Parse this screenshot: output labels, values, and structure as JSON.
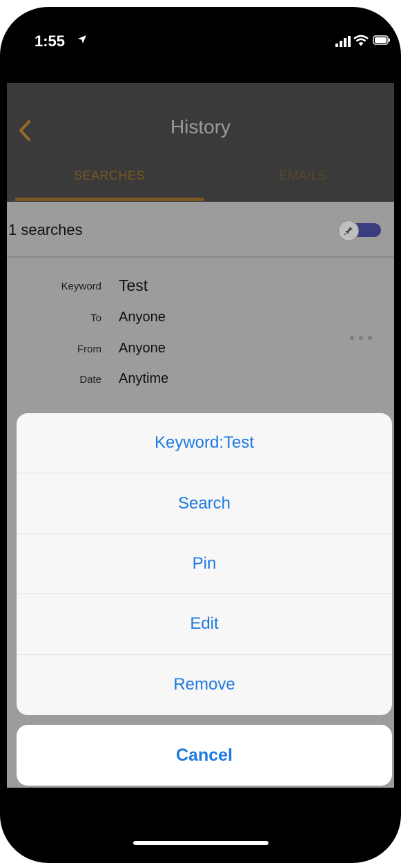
{
  "status_bar": {
    "time": "1:55",
    "icons": [
      "location-arrow-icon",
      "cellular-signal-icon",
      "wifi-icon",
      "battery-icon"
    ]
  },
  "nav": {
    "title": "History",
    "back_icon": "chevron-left-icon",
    "tabs": [
      {
        "label": "SEARCHES",
        "active": true
      },
      {
        "label": "EMAILS",
        "active": false
      }
    ]
  },
  "list_header": {
    "count_text": "1 searches",
    "toggle_icon": "pin-icon"
  },
  "search_item": {
    "fields": [
      {
        "label": "Keyword",
        "value": "Test"
      },
      {
        "label": "To",
        "value": "Anyone"
      },
      {
        "label": "From",
        "value": "Anyone"
      },
      {
        "label": "Date",
        "value": "Anytime"
      }
    ],
    "more_icon": "more-horizontal-icon"
  },
  "action_sheet": {
    "title": "Keyword:Test",
    "items": [
      "Search",
      "Pin",
      "Edit",
      "Remove"
    ],
    "cancel": "Cancel"
  },
  "colors": {
    "accent": "#e3901d",
    "action_blue": "#1e7ae0",
    "header_bg": "#3a3a3a",
    "toggle": "#3b3d80"
  }
}
